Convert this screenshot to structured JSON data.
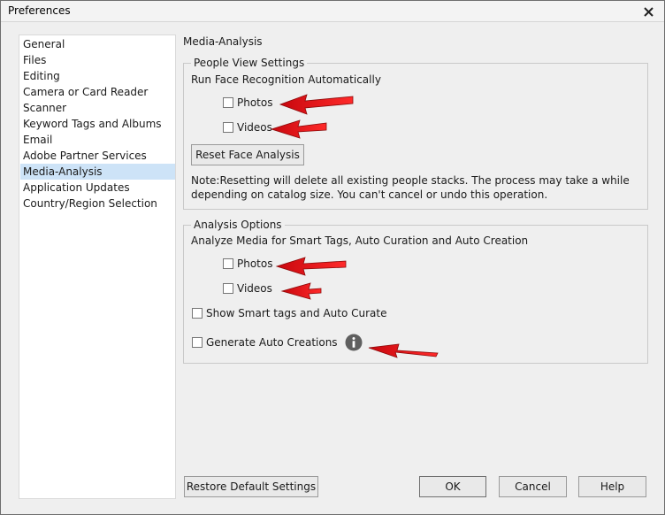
{
  "window": {
    "title": "Preferences"
  },
  "sidebar": {
    "items": [
      {
        "label": "General"
      },
      {
        "label": "Files"
      },
      {
        "label": "Editing"
      },
      {
        "label": "Camera or Card Reader"
      },
      {
        "label": "Scanner"
      },
      {
        "label": "Keyword Tags and Albums"
      },
      {
        "label": "Email"
      },
      {
        "label": "Adobe Partner Services"
      },
      {
        "label": "Media-Analysis",
        "selected": true
      },
      {
        "label": "Application Updates"
      },
      {
        "label": "Country/Region Selection"
      }
    ]
  },
  "main": {
    "section_title": "Media-Analysis",
    "people_view": {
      "legend": "People View Settings",
      "heading": "Run Face Recognition Automatically",
      "photos_label": "Photos",
      "photos_checked": false,
      "videos_label": "Videos",
      "videos_checked": false,
      "reset_button": "Reset Face Analysis",
      "note_line1": "Note:Resetting will delete all existing people stacks. The process may take a while",
      "note_line2": "depending on catalog size. You can't cancel or undo this operation."
    },
    "analysis": {
      "legend": "Analysis Options",
      "heading": "Analyze Media for Smart Tags, Auto Curation and Auto Creation",
      "photos_label": "Photos",
      "photos_checked": false,
      "videos_label": "Videos",
      "videos_checked": false,
      "smart_tags_label": "Show Smart tags and Auto Curate",
      "smart_tags_checked": false,
      "auto_creations_label": "Generate Auto Creations",
      "auto_creations_checked": false,
      "info_icon": "info-icon"
    }
  },
  "footer": {
    "restore_button": "Restore Default Settings",
    "ok_button": "OK",
    "cancel_button": "Cancel",
    "help_button": "Help"
  },
  "colors": {
    "window_bg": "#efefef",
    "selection": "#cde3f7",
    "annotation_arrow": "#e8141b"
  }
}
